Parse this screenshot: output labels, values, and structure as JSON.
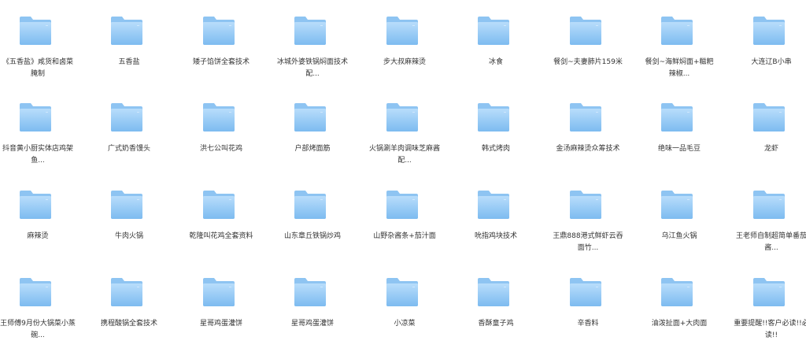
{
  "folder_colors": {
    "back": "#8EC4F2",
    "front_top": "#B8DDFB",
    "front_bottom": "#7DBBF0"
  },
  "folders": [
    {
      "label": "《五香盐》咸货和卤菜腌制",
      "icon": "folder-icon"
    },
    {
      "label": "五香盐",
      "icon": "folder-icon"
    },
    {
      "label": "矮子馅饼全套技术",
      "icon": "folder-icon"
    },
    {
      "label": "冰城外婆铁锅焖面技术配...",
      "icon": "folder-icon"
    },
    {
      "label": "步大叔麻辣烫",
      "icon": "folder-icon"
    },
    {
      "label": "冰食",
      "icon": "folder-icon"
    },
    {
      "label": "餐剑~夫妻肺片159米",
      "icon": "folder-icon"
    },
    {
      "label": "餐剑~海鲜焖面+糍粑辣椒...",
      "icon": "folder-icon"
    },
    {
      "label": "大连辽B小串",
      "icon": "folder-icon"
    },
    {
      "label": "抖音黄小厨实体店鸡架鱼...",
      "icon": "folder-icon"
    },
    {
      "label": "广式奶香馒头",
      "icon": "folder-icon"
    },
    {
      "label": "洪七公叫花鸡",
      "icon": "folder-icon"
    },
    {
      "label": "户部烤面筋",
      "icon": "folder-icon"
    },
    {
      "label": "火锅涮羊肉调味芝麻酱配...",
      "icon": "folder-icon"
    },
    {
      "label": "韩式烤肉",
      "icon": "folder-icon"
    },
    {
      "label": "金汤麻辣烫众筹技术",
      "icon": "folder-icon"
    },
    {
      "label": "绝味一品毛豆",
      "icon": "folder-icon"
    },
    {
      "label": "龙虾",
      "icon": "folder-icon"
    },
    {
      "label": "麻辣烫",
      "icon": "folder-icon"
    },
    {
      "label": "牛肉火锅",
      "icon": "folder-icon"
    },
    {
      "label": "乾隆叫花鸡全套资料",
      "icon": "folder-icon"
    },
    {
      "label": "山东章丘铁锅炒鸡",
      "icon": "folder-icon"
    },
    {
      "label": "山野杂酱条+茄汁面",
      "icon": "folder-icon"
    },
    {
      "label": "吮指鸡块技术",
      "icon": "folder-icon"
    },
    {
      "label": "王鼎888港式鲜虾云吞面竹...",
      "icon": "folder-icon"
    },
    {
      "label": "乌江鱼火锅",
      "icon": "folder-icon"
    },
    {
      "label": "王老师自制超简单番茄酱...",
      "icon": "folder-icon"
    },
    {
      "label": "王师傅9月份大锅菜小蒸碗...",
      "icon": "folder-icon"
    },
    {
      "label": "携程酸锅全套技术",
      "icon": "folder-icon"
    },
    {
      "label": "星哥鸡蛋灌饼",
      "icon": "folder-icon"
    },
    {
      "label": "星哥鸡蛋灌饼",
      "icon": "folder-icon"
    },
    {
      "label": "小凉菜",
      "icon": "folder-icon"
    },
    {
      "label": "香酥童子鸡",
      "icon": "folder-icon"
    },
    {
      "label": "辛香料",
      "icon": "folder-icon"
    },
    {
      "label": "油泼扯面+大肉面",
      "icon": "folder-icon"
    },
    {
      "label": "重要提醒!!客户必读!!必读!!",
      "icon": "folder-icon"
    }
  ]
}
